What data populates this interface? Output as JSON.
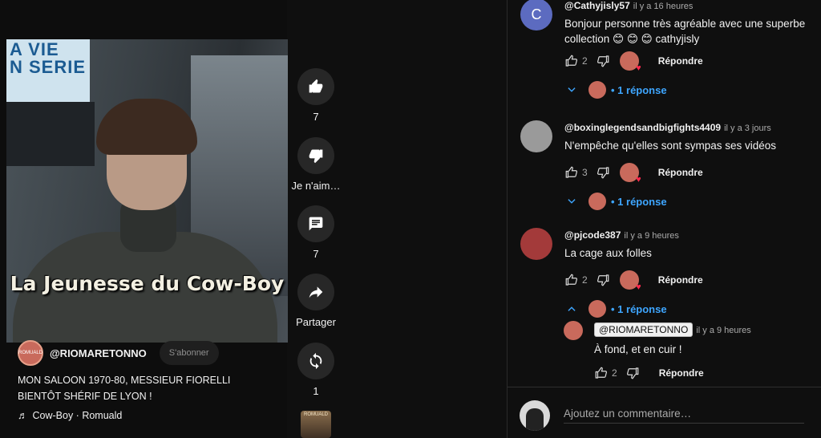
{
  "video": {
    "monitor_text": "A VIE\nN SERIE",
    "caption": "La Jeunesse du Cow-Boy",
    "channel": "@RIOMARETONNO",
    "subscribe_label": "S'abonner",
    "title": "MON SALOON 1970-80, MESSIEUR FIORELLI BIENTÔT SHÉRIF DE LYON !",
    "music": "Cow-Boy · Romuald",
    "mini_thumb_text": "ROMUALD"
  },
  "actions": {
    "like_count": "7",
    "dislike_label": "Je n'aim…",
    "comments_count": "7",
    "share_label": "Partager",
    "remix_count": "1"
  },
  "comments": [
    {
      "author": "@Cathyjisly57",
      "time": "il y a 16 heures",
      "text": "Bonjour   personne très agréable   avec une superbe collection   😊 😊 😊 cathyjisly",
      "likes": "2",
      "reply_label": "Répondre",
      "replies_label": "1 réponse",
      "avatar_letter": "C",
      "avatar_color": "#5c6bc0"
    },
    {
      "author": "@boxinglegendsandbigfights4409",
      "time": "il y a 3 jours",
      "text": "N'empêche qu'elles sont sympas ses vidéos",
      "likes": "3",
      "reply_label": "Répondre",
      "replies_label": "1 réponse"
    },
    {
      "author": "@pjcode387",
      "time": "il y a 9 heures",
      "text": "La cage aux folles",
      "likes": "2",
      "reply_label": "Répondre",
      "replies_label": "1 réponse"
    }
  ],
  "reply": {
    "author": "@RIOMARETONNO",
    "time": "il y a 9 heures",
    "text": "À fond, et en cuir !",
    "likes": "2",
    "reply_label": "Répondre"
  },
  "add_comment": {
    "placeholder": "Ajoutez un commentaire…"
  },
  "colors": {
    "link": "#3ea6ff",
    "heart": "#ff2a4d"
  }
}
